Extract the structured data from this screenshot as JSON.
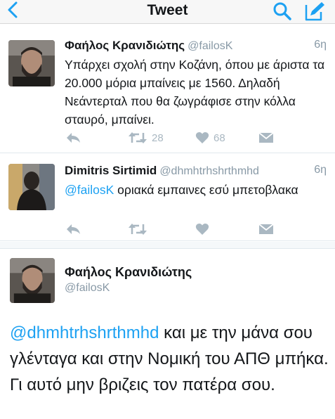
{
  "nav": {
    "title": "Tweet",
    "back_icon": "chevron-left-icon",
    "search_icon": "search-icon",
    "compose_icon": "compose-icon",
    "accent": "#1da1f2"
  },
  "tweets": [
    {
      "name": "Φαήλος Κρανιδιώτης",
      "handle": "@failosK",
      "time": "6η",
      "mention": "",
      "text": "Υπάρχει σχολή στην Κοζάνη, όπου με άριστα τα 20.000 μόρια μπαίνεις με 1560. Δηλαδή  Νεάντερταλ που θα ζωγράφισε στην κόλλα σταυρό, μπαίνει.",
      "retweets": "28",
      "likes": "68"
    },
    {
      "name": "Dimitris Sirtimid",
      "handle": "@dhmhtrhshrthmhd",
      "time": "6η",
      "mention": "@failosK",
      "text": " οριακά εμπαινες εσύ μπετοβλακα",
      "retweets": "",
      "likes": ""
    }
  ],
  "focused": {
    "name": "Φαήλος Κρανιδιώτης",
    "handle": "@failosK",
    "mention": "@dhmhtrhshrthmhd",
    "text": " και με την μάνα σου γλένταγα και στην Νομική του ΑΠΘ μπήκα. Γι αυτό μην βριζεις τον πατέρα σου."
  },
  "icons": {
    "reply": "reply-icon",
    "retweet": "retweet-icon",
    "like": "heart-icon",
    "dm": "envelope-icon"
  },
  "colors": {
    "text": "#14171a",
    "muted": "#8899a6",
    "action": "#aab8c2",
    "link": "#1da1f2"
  }
}
